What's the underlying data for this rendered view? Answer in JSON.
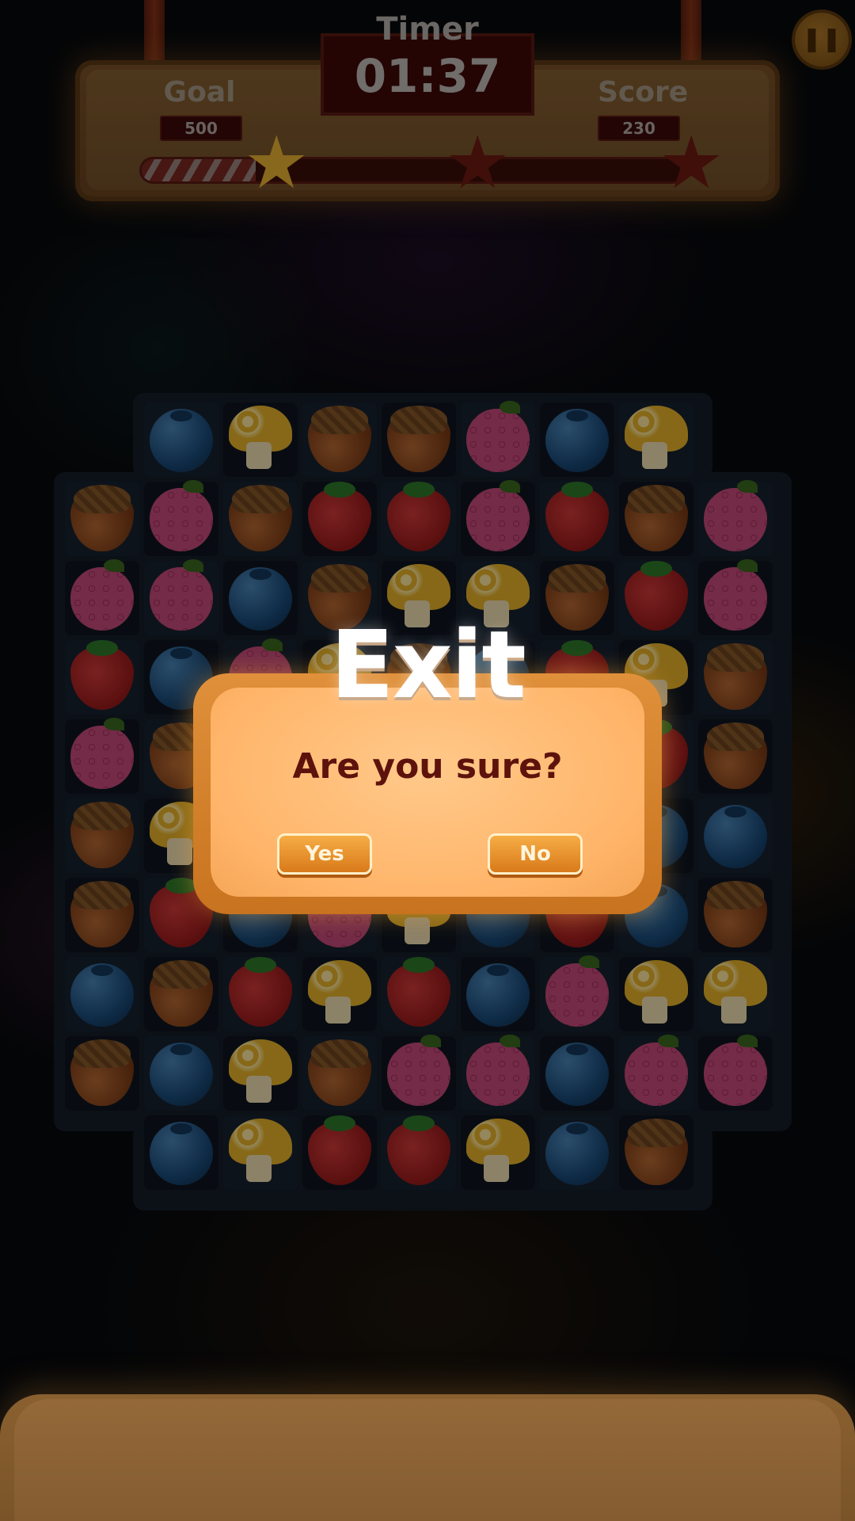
{
  "hud": {
    "timer_label": "Timer",
    "timer_value": "01:37",
    "goal_label": "Goal",
    "goal_value": "500",
    "score_label": "Score",
    "score_value": "230",
    "progress": 0.21,
    "stars_earned": 1,
    "stars_total": 3,
    "pause_icon": "pause-icon"
  },
  "board": {
    "pieces": [
      "blueberry",
      "raspberry",
      "acorn",
      "strawberry",
      "mushroom"
    ],
    "grid": [
      [
        null,
        "blueberry",
        "mushroom",
        "acorn",
        "acorn",
        "raspberry",
        "blueberry",
        "mushroom",
        null
      ],
      [
        "acorn",
        "raspberry",
        "acorn",
        "strawberry",
        "strawberry",
        "raspberry",
        "strawberry",
        "acorn",
        "raspberry"
      ],
      [
        "raspberry",
        "raspberry",
        "blueberry",
        "acorn",
        "mushroom",
        "mushroom",
        "acorn",
        "strawberry",
        "raspberry"
      ],
      [
        "strawberry",
        "blueberry",
        "raspberry",
        "mushroom",
        "acorn",
        "blueberry",
        "strawberry",
        "mushroom",
        "acorn"
      ],
      [
        "raspberry",
        "acorn",
        "strawberry",
        "blueberry",
        "raspberry",
        "acorn",
        "mushroom",
        "strawberry",
        "acorn"
      ],
      [
        "acorn",
        "mushroom",
        "acorn",
        "strawberry",
        "blueberry",
        "raspberry",
        "acorn",
        "blueberry",
        "blueberry"
      ],
      [
        "acorn",
        "strawberry",
        "blueberry",
        "raspberry",
        "mushroom",
        "blueberry",
        "strawberry",
        "blueberry",
        "acorn"
      ],
      [
        "blueberry",
        "acorn",
        "strawberry",
        "mushroom",
        "strawberry",
        "blueberry",
        "raspberry",
        "mushroom",
        "mushroom"
      ],
      [
        "acorn",
        "blueberry",
        "mushroom",
        "acorn",
        "raspberry",
        "raspberry",
        "blueberry",
        "raspberry",
        "raspberry"
      ],
      [
        null,
        "blueberry",
        "mushroom",
        "strawberry",
        "strawberry",
        "mushroom",
        "blueberry",
        "acorn",
        null
      ]
    ]
  },
  "dialog": {
    "title": "Exit",
    "message": "Are you sure?",
    "yes_label": "Yes",
    "no_label": "No"
  },
  "colors": {
    "dialog_fill": "#ffb56a",
    "dialog_border": "#d98228",
    "message_text": "#5e120c",
    "hud_panel": "#7a5328",
    "timer_box": "#3e0a08"
  }
}
